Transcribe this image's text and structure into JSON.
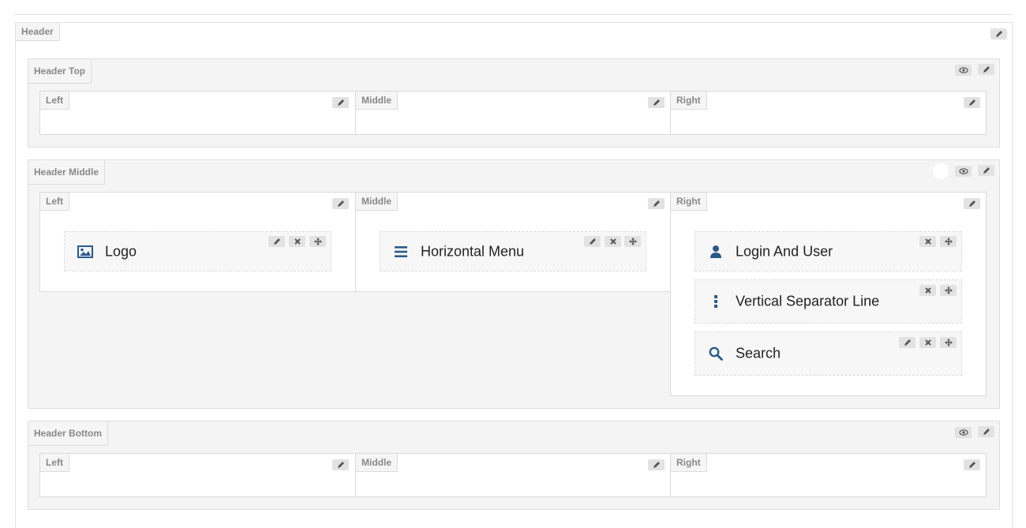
{
  "header": {
    "title": "Header",
    "sections": {
      "top": {
        "title": "Header Top",
        "columns": {
          "left": "Left",
          "middle": "Middle",
          "right": "Right"
        }
      },
      "middle": {
        "title": "Header Middle",
        "columns": {
          "left": "Left",
          "middle": "Middle",
          "right": "Right"
        },
        "widgets": {
          "logo": {
            "label": "Logo",
            "icon": "image-icon"
          },
          "horizontal_menu": {
            "label": "Horizontal Menu",
            "icon": "bars-icon"
          },
          "login_user": {
            "label": "Login And User",
            "icon": "user-icon"
          },
          "separator": {
            "label": "Vertical Separator Line",
            "icon": "ellipsis-vertical-icon"
          },
          "search": {
            "label": "Search",
            "icon": "search-icon"
          }
        }
      },
      "bottom": {
        "title": "Header Bottom",
        "columns": {
          "left": "Left",
          "middle": "Middle",
          "right": "Right"
        }
      }
    }
  },
  "colors": {
    "accent": "#2a5a8a",
    "panel": "#f4f4f4",
    "button": "#e2e2e2"
  }
}
